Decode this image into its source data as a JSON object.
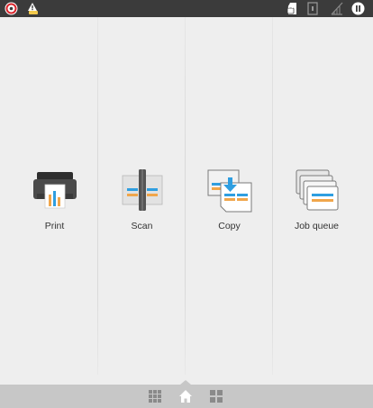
{
  "colors": {
    "topbar": "#3b3b3b",
    "background": "#eeeeee",
    "bottombar": "#c7c7c7",
    "accent_blue": "#2f9ee0",
    "accent_orange": "#f0a64b"
  },
  "topbar": {
    "left_icons": [
      "hp-status-icon",
      "warning-supply-icon"
    ],
    "right_icons": [
      "security-lock-icon",
      "usb-storage-icon",
      "wifi-disabled-icon",
      "pause-icon"
    ]
  },
  "tiles": [
    {
      "label": "Print",
      "icon": "print-icon"
    },
    {
      "label": "Scan",
      "icon": "scan-icon"
    },
    {
      "label": "Copy",
      "icon": "copy-icon"
    },
    {
      "label": "Job queue",
      "icon": "job-queue-icon"
    }
  ],
  "bottombar": {
    "items": [
      "apps-grid-icon",
      "home-icon",
      "widgets-icon"
    ]
  }
}
